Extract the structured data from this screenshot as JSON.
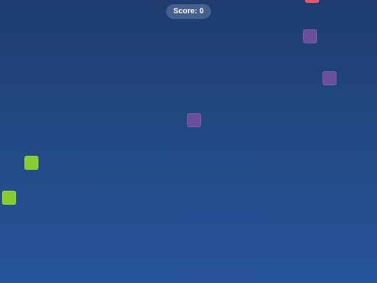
{
  "hud": {
    "score_label": "Score:",
    "score_value": "0"
  },
  "colors": {
    "background_top": "#1e3c6e",
    "background_bottom": "#27539a",
    "purple_block": "#6b4f9a",
    "green_block": "#86cc2c",
    "red_block": "#e8506c"
  }
}
